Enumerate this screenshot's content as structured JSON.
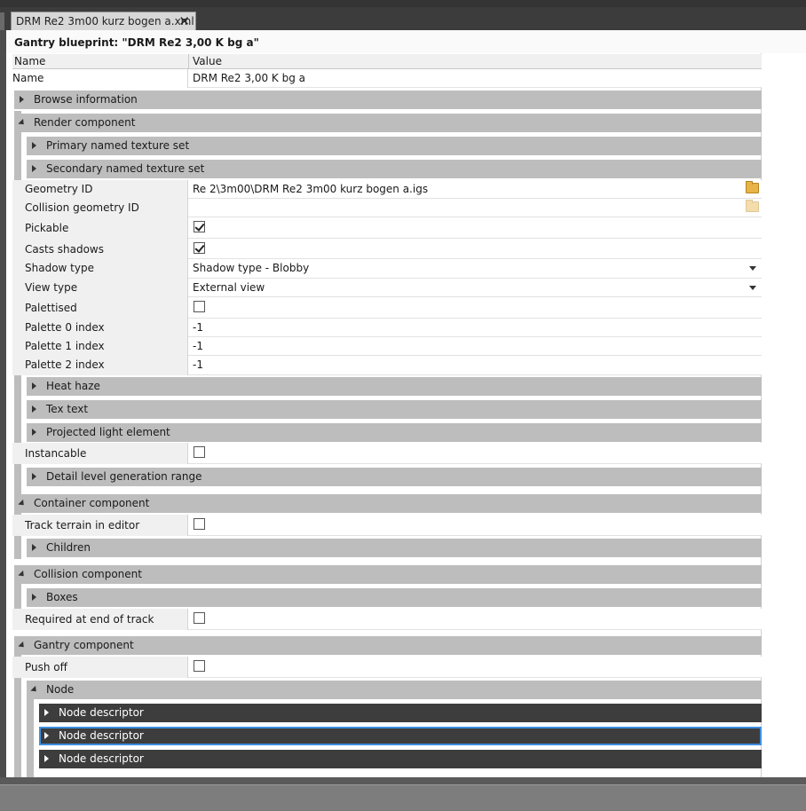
{
  "tab": {
    "title": "DRM Re2 3m00 kurz bogen a.xml",
    "close": "✕"
  },
  "panel_title": "Gantry blueprint: \"DRM Re2 3,00 K bg a\"",
  "grid": {
    "col_name": "Name",
    "col_value": "Value",
    "name_label": "Name",
    "name_value": "DRM Re2 3,00 K bg a",
    "browse_information": "Browse information",
    "render": {
      "label": "Render component",
      "primary_texture": "Primary named texture set",
      "secondary_texture": "Secondary named texture set",
      "geometry_id_label": "Geometry ID",
      "geometry_id_value": "Re 2\\3m00\\DRM Re2 3m00 kurz bogen a.igs",
      "collision_geometry_label": "Collision geometry ID",
      "collision_geometry_value": "",
      "pickable_label": "Pickable",
      "pickable": true,
      "casts_shadows_label": "Casts shadows",
      "casts_shadows": true,
      "shadow_type_label": "Shadow type",
      "shadow_type_value": "Shadow type - Blobby",
      "view_type_label": "View type",
      "view_type_value": "External view",
      "palettised_label": "Palettised",
      "palettised": false,
      "palette0_label": "Palette 0 index",
      "palette0_value": "-1",
      "palette1_label": "Palette 1 index",
      "palette1_value": "-1",
      "palette2_label": "Palette 2 index",
      "palette2_value": "-1",
      "heat_haze": "Heat haze",
      "tex_text": "Tex text",
      "projected_light": "Projected light element",
      "instancable_label": "Instancable",
      "instancable": false,
      "detail_level": "Detail level generation range"
    },
    "container": {
      "label": "Container component",
      "track_terrain_label": "Track terrain in editor",
      "track_terrain": false,
      "children": "Children"
    },
    "collision": {
      "label": "Collision component",
      "boxes": "Boxes",
      "required_end_label": "Required at end of track",
      "required_end": false
    },
    "gantry": {
      "label": "Gantry component",
      "push_off_label": "Push off",
      "push_off": false,
      "node": "Node",
      "node_descriptors": [
        "Node descriptor",
        "Node descriptor",
        "Node descriptor"
      ]
    }
  },
  "colors": {
    "group_bg": "#bdbdbd",
    "dark_group_bg": "#3d3d3d",
    "selection": "#3d8ee0"
  }
}
